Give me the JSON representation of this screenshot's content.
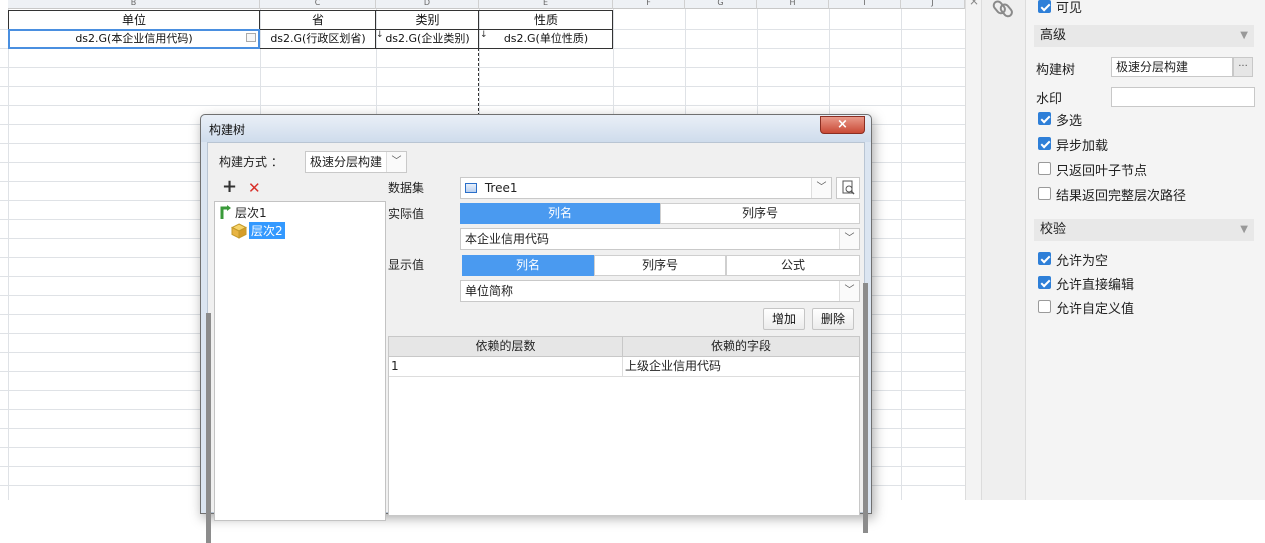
{
  "spreadsheet": {
    "column_headers": [
      "B",
      "C",
      "D",
      "E",
      "F",
      "G",
      "H",
      "I",
      "J"
    ],
    "header_row": [
      "单位",
      "省",
      "类别",
      "性质"
    ],
    "data_row": [
      "ds2.G(本企业信用代码)",
      "ds2.G(行政区划省)",
      "ds2.G(企业类别)",
      "ds2.G(单位性质)"
    ]
  },
  "dialog": {
    "title": "构建树",
    "close_glyph": "×",
    "build_mode_label": "构建方式 ：",
    "build_mode_value": "极速分层构建",
    "add_glyph": "+",
    "delete_glyph": "✕",
    "tree": {
      "level1": "层次1",
      "level2": "层次2"
    },
    "dataset_label": "数据集",
    "dataset_value": "Tree1",
    "actual_value_label": "实际值",
    "actual_tabs": [
      "列名",
      "列序号"
    ],
    "actual_value": "本企业信用代码",
    "display_value_label": "显示值",
    "display_tabs": [
      "列名",
      "列序号",
      "公式"
    ],
    "display_value": "单位简称",
    "add_button": "增加",
    "delete_button": "删除",
    "grid": {
      "headers": [
        "依赖的层数",
        "依赖的字段"
      ],
      "rows": [
        [
          "1",
          "上级企业信用代码"
        ]
      ]
    }
  },
  "panel": {
    "visible_label": "可见",
    "advanced_section": "高级",
    "build_tree_label": "构建树",
    "build_tree_value": "极速分层构建",
    "build_tree_btn": "···",
    "watermark_label": "水印",
    "watermark_value": "",
    "options": [
      {
        "label": "多选",
        "checked": true
      },
      {
        "label": "异步加载",
        "checked": true
      },
      {
        "label": "只返回叶子节点",
        "checked": false
      },
      {
        "label": "结果返回完整层次路径",
        "checked": false
      }
    ],
    "validate_section": "校验",
    "validate_options": [
      {
        "label": "允许为空",
        "checked": true
      },
      {
        "label": "允许直接编辑",
        "checked": true
      },
      {
        "label": "允许自定义值",
        "checked": false
      }
    ]
  },
  "colors": {
    "accent": "#4a9af0",
    "checkbox": "#2e7fd8",
    "close_red": "#c94a36"
  }
}
